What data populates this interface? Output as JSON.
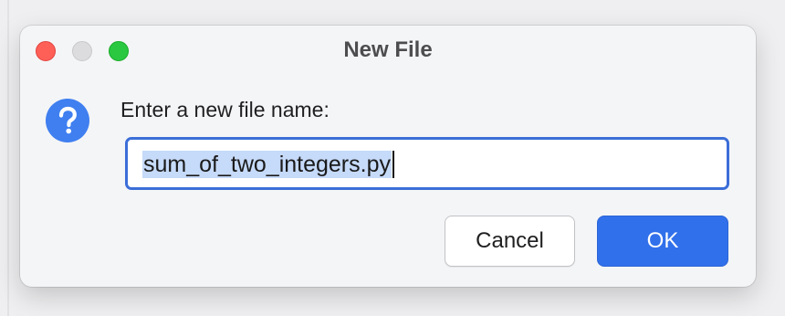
{
  "dialog": {
    "title": "New File",
    "prompt": "Enter a new file name:",
    "filename_value": "sum_of_two_integers.py",
    "cancel_label": "Cancel",
    "ok_label": "OK",
    "icon": "question-icon",
    "window_controls": [
      "close",
      "minimize",
      "zoom"
    ]
  },
  "colors": {
    "accent": "#3170eb",
    "focus_ring": "#3b6ed8",
    "selection": "#c6daf9",
    "close": "#fe5f57",
    "zoom": "#29c840",
    "minimize_disabled": "#dcdcde",
    "icon_blue": "#3f7ff0"
  }
}
